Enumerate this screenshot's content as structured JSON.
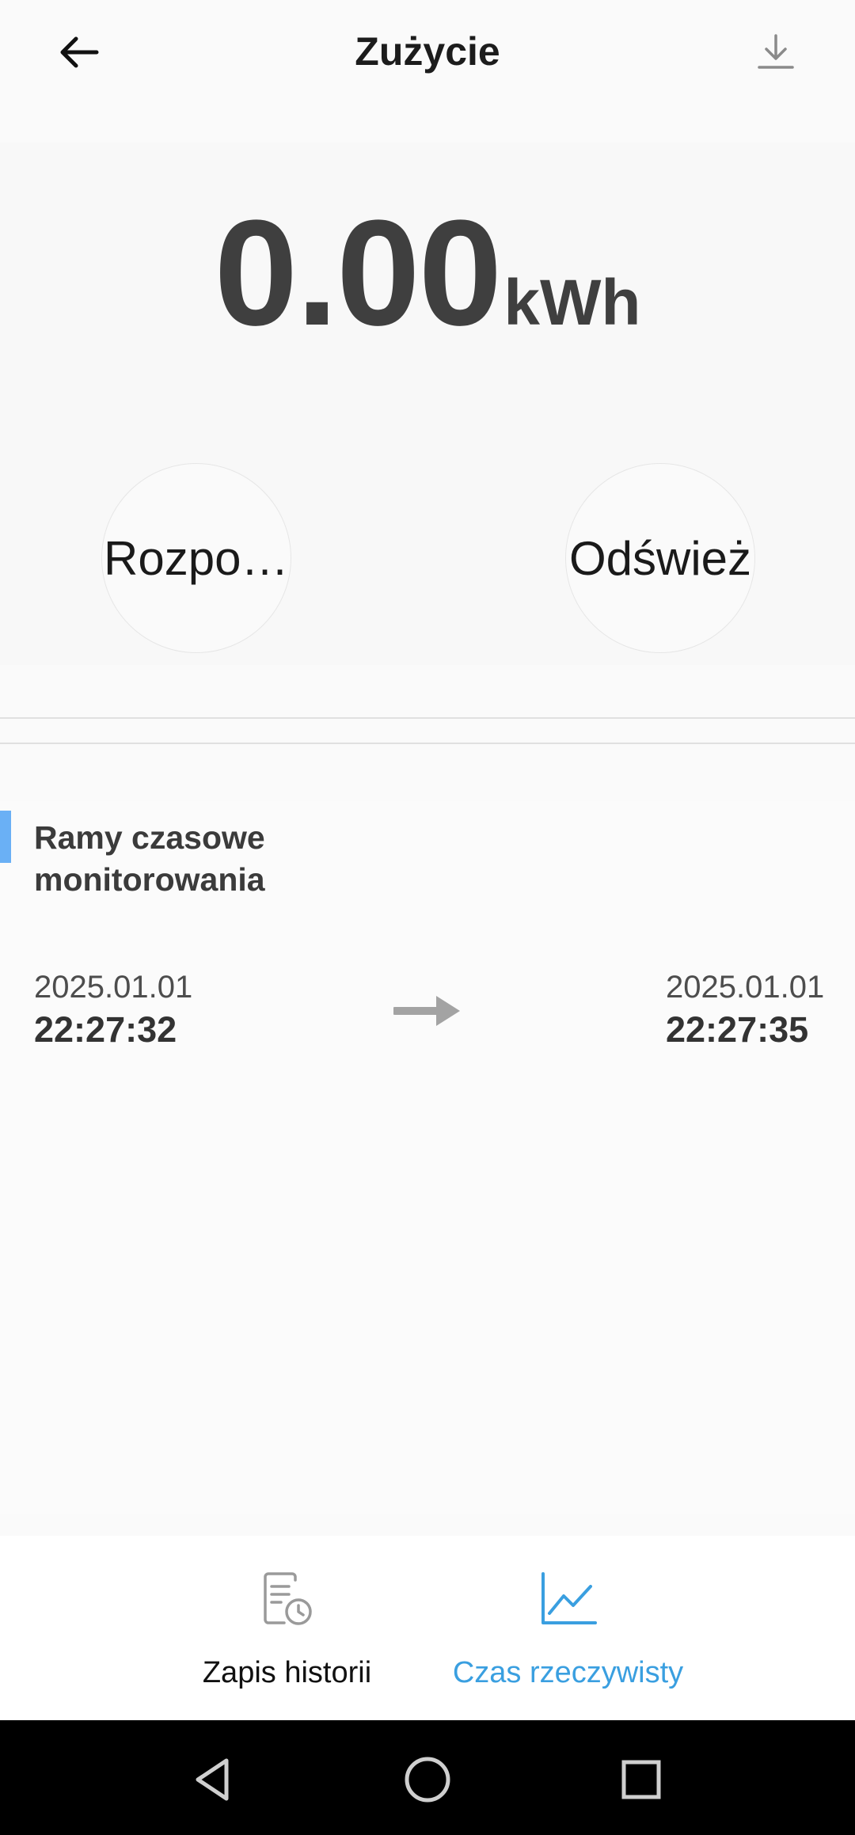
{
  "header": {
    "title": "Zużycie",
    "back_icon": "arrow-left-icon",
    "download_icon": "download-icon"
  },
  "usage": {
    "value": "0.00",
    "unit": "kWh"
  },
  "actions": {
    "start_label": "Rozpoc...",
    "refresh_label": "Odśwież"
  },
  "monitoring": {
    "title": "Ramy czasowe monitorowania",
    "start": {
      "date": "2025.01.01",
      "time": "22:27:32"
    },
    "end": {
      "date": "2025.01.01",
      "time": "22:27:35"
    },
    "arrow_icon": "arrow-right-icon"
  },
  "tabs": [
    {
      "label": "Zapis historii",
      "icon": "history-record-icon",
      "active": false
    },
    {
      "label": "Czas rzeczywisty",
      "icon": "line-chart-icon",
      "active": true
    }
  ],
  "colors": {
    "accent": "#3a9fe0",
    "accent_bar": "#6ab0f5",
    "value_text": "#3f3f3f",
    "nav_bar": "#000000"
  },
  "system_nav": {
    "back_icon": "nav-back-triangle-icon",
    "home_icon": "nav-home-circle-icon",
    "recent_icon": "nav-recent-square-icon"
  }
}
